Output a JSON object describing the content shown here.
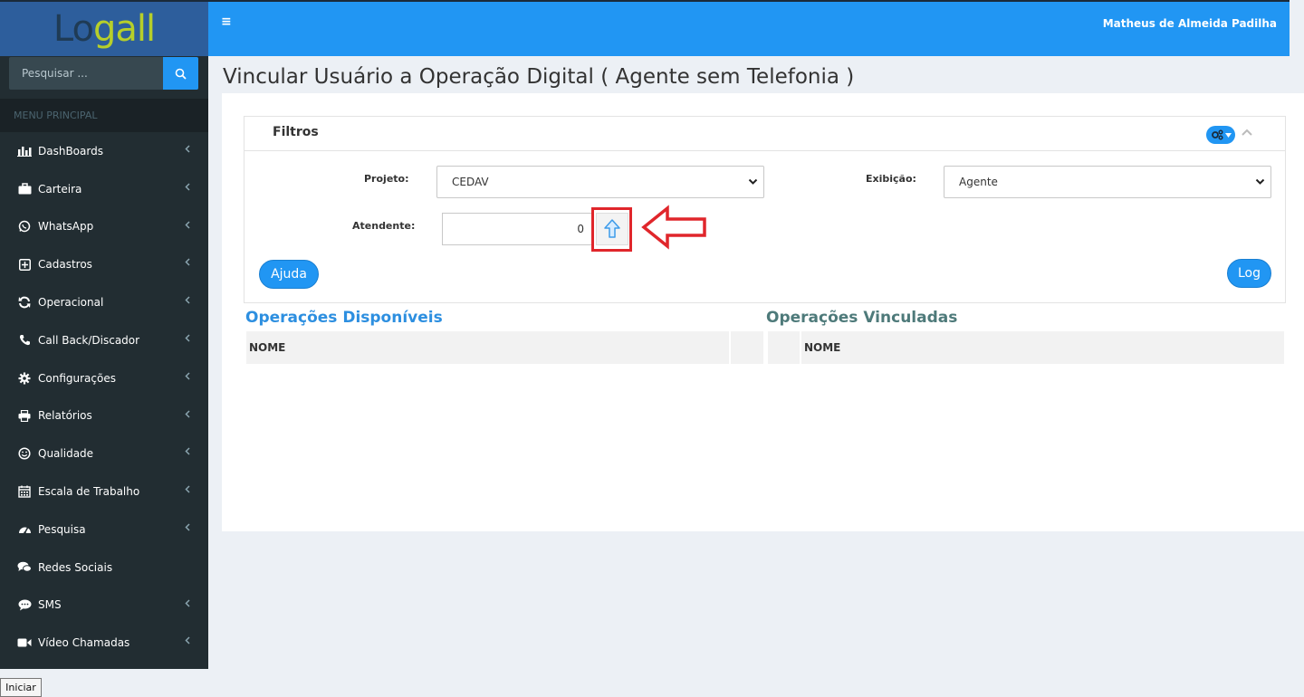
{
  "app": {
    "logo_text_part1": "Lo",
    "logo_text_part2": "gall",
    "user_name": "Matheus de Almeida Padilha"
  },
  "sidebar": {
    "search_placeholder": "Pesquisar ...",
    "menu_header": "MENU PRINCIPAL",
    "items": [
      {
        "label": "DashBoards",
        "icon": "bar-chart-icon",
        "has_submenu": true
      },
      {
        "label": "Carteira",
        "icon": "briefcase-icon",
        "has_submenu": true
      },
      {
        "label": "WhatsApp",
        "icon": "whatsapp-icon",
        "has_submenu": true
      },
      {
        "label": "Cadastros",
        "icon": "plus-square-icon",
        "has_submenu": true
      },
      {
        "label": "Operacional",
        "icon": "refresh-icon",
        "has_submenu": true
      },
      {
        "label": "Call Back/Discador",
        "icon": "phone-icon",
        "has_submenu": true
      },
      {
        "label": "Configurações",
        "icon": "gear-icon",
        "has_submenu": true
      },
      {
        "label": "Relatórios",
        "icon": "printer-icon",
        "has_submenu": true
      },
      {
        "label": "Qualidade",
        "icon": "smile-icon",
        "has_submenu": true
      },
      {
        "label": "Escala de Trabalho",
        "icon": "calendar-icon",
        "has_submenu": true
      },
      {
        "label": "Pesquisa",
        "icon": "dashboard-icon",
        "has_submenu": true
      },
      {
        "label": "Redes Sociais",
        "icon": "comments-icon",
        "has_submenu": false
      },
      {
        "label": "SMS",
        "icon": "chat-bubble-icon",
        "has_submenu": true
      },
      {
        "label": "Vídeo Chamadas",
        "icon": "video-icon",
        "has_submenu": true
      }
    ]
  },
  "page": {
    "title": "Vincular Usuário a Operação Digital ( Agente sem Telefonia )"
  },
  "filters": {
    "title": "Filtros",
    "projeto_label": "Projeto:",
    "projeto_value": "CEDAV",
    "exibicao_label": "Exibição:",
    "exibicao_value": "Agente",
    "atendente_label": "Atendente:",
    "atendente_value": "0",
    "ajuda_label": "Ajuda",
    "log_label": "Log"
  },
  "tables": {
    "disponiveis_title": "Operações Disponíveis",
    "vinculadas_title": "Operações Vinculadas",
    "col_nome": "NOME"
  },
  "taskbar": {
    "start_label": "Iniciar"
  },
  "colors": {
    "primary": "#2196f3",
    "sidebar_bg": "#222d32",
    "title_blue": "#2d8fe0",
    "title_teal": "#4e7a7a",
    "highlight_red": "#e0262b"
  }
}
